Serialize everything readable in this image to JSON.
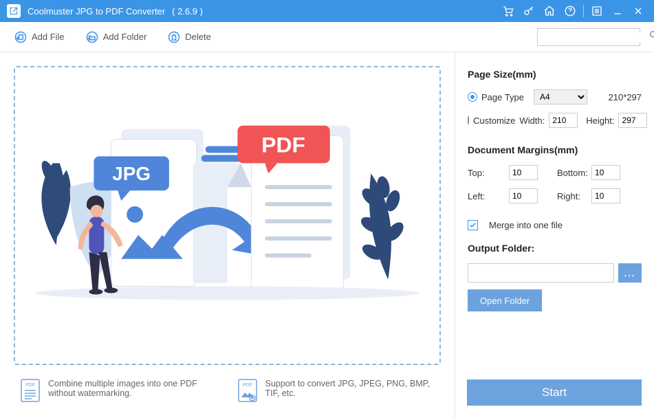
{
  "titlebar": {
    "app_name": "Coolmuster JPG to PDF Converter",
    "version": "( 2.6.9 )"
  },
  "toolbar": {
    "add_file": "Add File",
    "add_folder": "Add Folder",
    "delete": "Delete",
    "search_placeholder": ""
  },
  "illustration": {
    "jpg_badge": "JPG",
    "pdf_badge": "PDF"
  },
  "info1": "Combine multiple images into one PDF without watermarking.",
  "info2": "Support to convert JPG, JPEG, PNG, BMP, TIF, etc.",
  "right": {
    "page_size_heading": "Page Size(mm)",
    "page_type_label": "Page Type",
    "page_type_value": "A4",
    "page_dims": "210*297",
    "customize_label": "Customize",
    "width_label": "Width:",
    "width_value": "210",
    "height_label": "Height:",
    "height_value": "297",
    "margins_heading": "Document Margins(mm)",
    "top_label": "Top:",
    "top_value": "10",
    "bottom_label": "Bottom:",
    "bottom_value": "10",
    "left_label": "Left:",
    "left_value": "10",
    "right_label": "Right:",
    "right_value": "10",
    "merge_label": "Merge into one file",
    "output_heading": "Output Folder:",
    "output_path": "",
    "browse_label": "...",
    "open_folder": "Open Folder",
    "start": "Start"
  }
}
